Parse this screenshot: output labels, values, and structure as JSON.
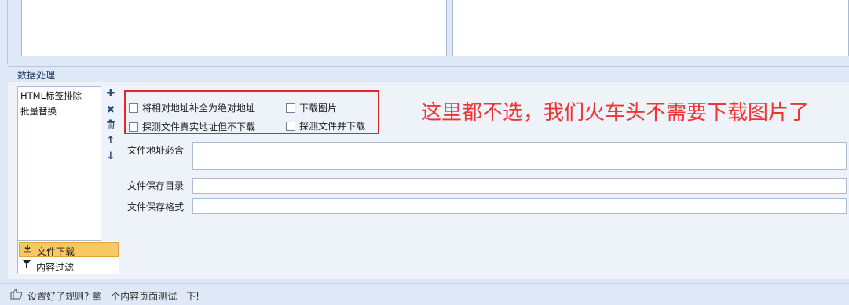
{
  "section": {
    "title": "数据处理"
  },
  "rule_list": {
    "items": [
      "HTML标签排除",
      "批量替换"
    ]
  },
  "toolbar_icons": [
    "plus-icon",
    "close-icon",
    "trash-icon",
    "arrow-up-icon",
    "arrow-down-icon"
  ],
  "tabs": [
    {
      "label": "文件下载",
      "icon": "download-icon",
      "selected": true
    },
    {
      "label": "内容过滤",
      "icon": "filter-icon",
      "selected": false
    }
  ],
  "options": {
    "complete_relative_url": {
      "label": "将相对地址补全为绝对地址",
      "checked": false
    },
    "download_images": {
      "label": "下载图片",
      "checked": false
    },
    "detect_real_url": {
      "label": "探测文件真实地址但不下载",
      "checked": false
    },
    "detect_and_download": {
      "label": "探测文件并下载",
      "checked": false
    }
  },
  "fields": {
    "url_must_contain": {
      "label": "文件地址必含",
      "value": ""
    },
    "save_dir": {
      "label": "文件保存目录",
      "value": ""
    },
    "save_format": {
      "label": "文件保存格式",
      "value": ""
    }
  },
  "annotation": {
    "text": "这里都不选，我们火车头不需要下载图片了"
  },
  "status": {
    "text": "设置好了规则? 拿一个内容页面测试一下!"
  },
  "colors": {
    "highlight_border": "#e0272b",
    "annotation": "#f03434",
    "selected_tab": "#f8c862"
  }
}
